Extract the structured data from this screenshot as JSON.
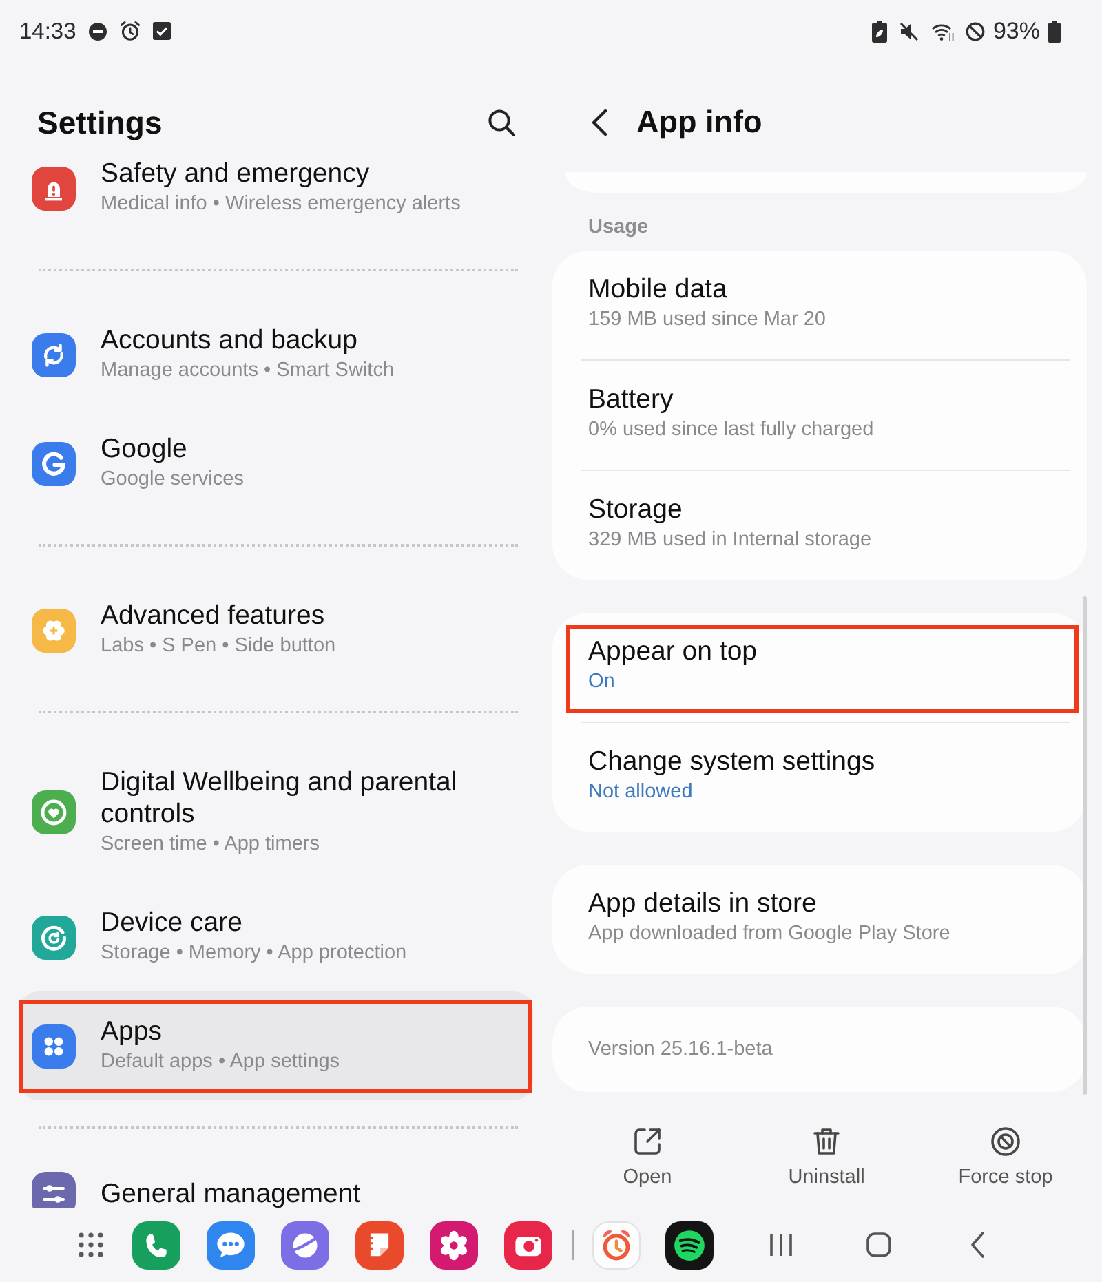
{
  "status_bar": {
    "time": "14:33",
    "battery_percent": "93%"
  },
  "settings": {
    "title": "Settings",
    "groups": [
      {
        "items": [
          {
            "title": "Safety and emergency",
            "subtitle": "Medical info • Wireless emergency alerts",
            "color": "#e0463e",
            "selected": false,
            "highlighted": false
          }
        ]
      },
      {
        "items": [
          {
            "title": "Accounts and backup",
            "subtitle": "Manage accounts • Smart Switch",
            "color": "#3b7cec",
            "selected": false,
            "highlighted": false
          },
          {
            "title": "Google",
            "subtitle": "Google services",
            "color": "#3b7cec",
            "selected": false,
            "highlighted": false
          }
        ]
      },
      {
        "items": [
          {
            "title": "Advanced features",
            "subtitle": "Labs • S Pen • Side button",
            "color": "#f6b847",
            "selected": false,
            "highlighted": false
          }
        ]
      },
      {
        "items": [
          {
            "title": "Digital Wellbeing and parental controls",
            "subtitle": "Screen time • App timers",
            "color": "#4cae4f",
            "selected": false,
            "highlighted": false
          },
          {
            "title": "Device care",
            "subtitle": "Storage • Memory • App protection",
            "color": "#22a898",
            "selected": false,
            "highlighted": false
          },
          {
            "title": "Apps",
            "subtitle": "Default apps • App settings",
            "color": "#3b7cec",
            "selected": true,
            "highlighted": true
          }
        ]
      },
      {
        "items": [
          {
            "title": "General management",
            "color": "#6c68ad",
            "selected": false,
            "highlighted": false
          }
        ]
      }
    ]
  },
  "app_info": {
    "title": "App info",
    "sections": [
      {
        "header": "Usage",
        "rows": [
          {
            "kind": "detail",
            "title": "Mobile data",
            "value": "159 MB used since Mar 20",
            "highlighted": false
          },
          {
            "kind": "detail",
            "title": "Battery",
            "value": "0% used since last fully charged",
            "highlighted": false
          },
          {
            "kind": "detail",
            "title": "Storage",
            "value": "329 MB used in Internal storage",
            "highlighted": false
          }
        ]
      },
      {
        "rows": [
          {
            "kind": "permission",
            "title": "Appear on top",
            "value": "On",
            "highlighted": true
          },
          {
            "kind": "permission",
            "title": "Change system settings",
            "value": "Not allowed",
            "highlighted": false
          }
        ]
      },
      {
        "rows": [
          {
            "kind": "detail",
            "title": "App details in store",
            "value": "App downloaded from Google Play Store",
            "highlighted": false
          }
        ]
      },
      {
        "rows": [
          {
            "kind": "note",
            "value": "Version 25.16.1-beta",
            "highlighted": false
          }
        ]
      }
    ]
  },
  "actions": [
    {
      "label": "Open"
    },
    {
      "label": "Uninstall"
    },
    {
      "label": "Force stop"
    }
  ]
}
